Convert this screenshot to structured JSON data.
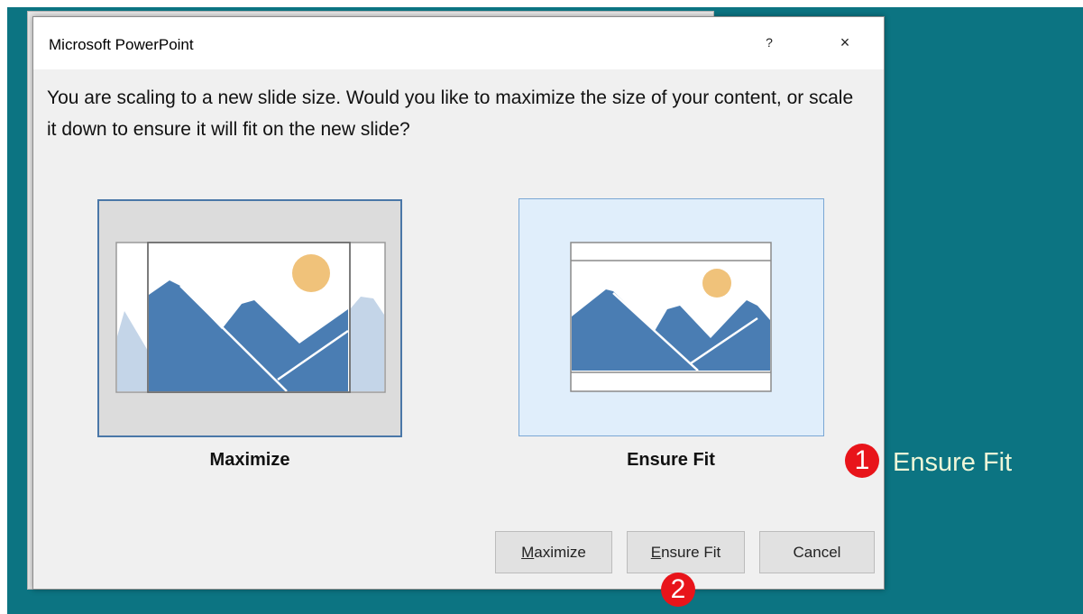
{
  "dialog": {
    "title": "Microsoft PowerPoint",
    "help_glyph": "?",
    "close_glyph": "×",
    "message": "You are scaling to a new slide size.  Would you like to maximize the size of your content, or scale it down to ensure it will fit on the new slide?"
  },
  "options": {
    "maximize_label": "Maximize",
    "ensure_fit_label": "Ensure Fit"
  },
  "buttons": {
    "maximize": {
      "accel": "M",
      "rest": "aximize"
    },
    "ensure_fit": {
      "accel": "E",
      "rest": "nsure Fit"
    },
    "cancel": "Cancel"
  },
  "annotations": {
    "step1_number": "1",
    "step1_text": "Ensure Fit",
    "step2_number": "2"
  },
  "colors": {
    "background": "#0c7482",
    "dialog_bg": "#f0f0f0",
    "mountain": "#4a7db3",
    "mountain_faded": "#c4d5e8",
    "sun": "#f0c27a",
    "marker": "#e8141a",
    "annotation_text": "#eef6d8"
  }
}
